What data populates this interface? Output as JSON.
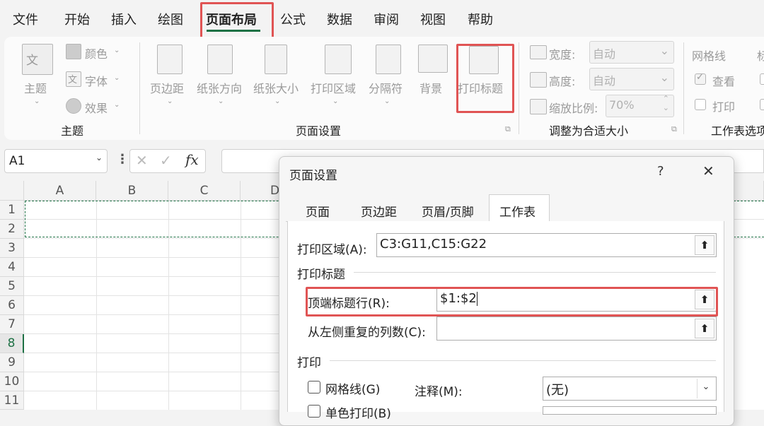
{
  "menu": {
    "items": [
      "文件",
      "开始",
      "插入",
      "绘图",
      "页面布局",
      "公式",
      "数据",
      "审阅",
      "视图",
      "帮助"
    ],
    "active": "页面布局"
  },
  "ribbon": {
    "theme_group": {
      "label": "主题",
      "themes_label": "主题",
      "colors_label": "颜色",
      "fonts_label": "字体",
      "effects_label": "效果"
    },
    "page_setup_group": {
      "label": "页面设置",
      "margins_label": "页边距",
      "orientation_label": "纸张方向",
      "size_label": "纸张大小",
      "print_area_label": "打印区域",
      "breaks_label": "分隔符",
      "background_label": "背景",
      "print_titles_label": "打印标题"
    },
    "scale_group": {
      "label": "调整为合适大小",
      "width_label": "宽度:",
      "width_value": "自动",
      "height_label": "高度:",
      "height_value": "自动",
      "scale_label": "缩放比例:",
      "scale_value": "70%"
    },
    "sheet_options_group": {
      "label": "工作表选项",
      "gridlines_label": "网格线",
      "view_label": "查看",
      "print_label": "打印",
      "headings_partial": "标"
    }
  },
  "formula_bar": {
    "name_box": "A1",
    "fx": "fx",
    "cancel": "✕",
    "enter": "✓"
  },
  "sheet": {
    "columns": [
      "A",
      "B",
      "C",
      "D"
    ],
    "rows": [
      "1",
      "2",
      "3",
      "4",
      "5",
      "6",
      "7",
      "8",
      "9",
      "10",
      "11"
    ],
    "selected_row": "8"
  },
  "dialog": {
    "title": "页面设置",
    "help": "?",
    "close": "✕",
    "tabs": [
      "页面",
      "页边距",
      "页眉/页脚",
      "工作表"
    ],
    "active_tab": "工作表",
    "print_area_label": "打印区域(A):",
    "print_area_value": "C3:G11,C15:G22",
    "print_titles_heading": "打印标题",
    "rows_to_repeat_label": "顶端标题行(R):",
    "rows_to_repeat_value": "$1:$2",
    "cols_to_repeat_label": "从左侧重复的列数(C):",
    "cols_to_repeat_value": "",
    "print_heading": "打印",
    "gridlines_label": "网格线(G)",
    "comments_label": "注释(M):",
    "comments_value": "(无)",
    "mono_label": "单色打印(B)"
  }
}
